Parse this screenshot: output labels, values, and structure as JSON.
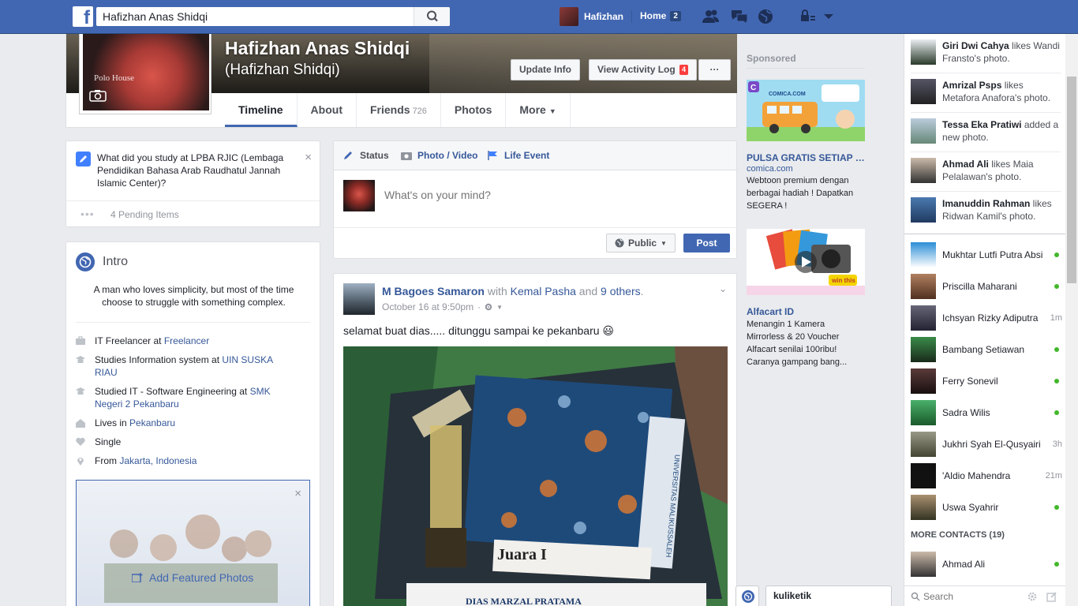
{
  "topbar": {
    "search_value": "Hafizhan Anas Shidqi",
    "user_name": "Hafizhan",
    "home_label": "Home",
    "home_count": "2"
  },
  "profile": {
    "name": "Hafizhan Anas Shidqi",
    "alt_name": "(Hafizhan Shidqi)",
    "picture_text": "Polo House",
    "update_info": "Update Info",
    "view_activity_log": "View Activity Log",
    "activity_count": "4",
    "more_button": "···",
    "tabs": [
      {
        "label": "Timeline",
        "count": ""
      },
      {
        "label": "About",
        "count": ""
      },
      {
        "label": "Friends",
        "count": "726"
      },
      {
        "label": "Photos",
        "count": ""
      },
      {
        "label": "More",
        "count": ""
      }
    ]
  },
  "study_card": {
    "question": "What did you study at LPBA RJIC (Lembaga Pendidikan Bahasa Arab Raudhatul Jannah Islamic Center)?",
    "close": "×",
    "pending_dots": "•••",
    "pending_label": "4 Pending Items"
  },
  "intro": {
    "title": "Intro",
    "bio": "A man who loves simplicity, but most of the time choose to struggle with something complex.",
    "rows": [
      {
        "prefix": "IT Freelancer at ",
        "link": "Freelancer",
        "suffix": ""
      },
      {
        "prefix": "Studies Information system at ",
        "link": "UIN SUSKA RIAU",
        "suffix": ""
      },
      {
        "prefix": "Studied IT - Software Engineering at ",
        "link": "SMK Negeri 2 Pekanbaru",
        "suffix": ""
      },
      {
        "prefix": "Lives in ",
        "link": "Pekanbaru",
        "suffix": ""
      },
      {
        "prefix": "Single",
        "link": "",
        "suffix": ""
      },
      {
        "prefix": "From ",
        "link": "Jakarta",
        "suffix": ", Indonesia"
      }
    ],
    "featured_close": "×",
    "featured_label": "Add Featured Photos"
  },
  "composer": {
    "tab_status": "Status",
    "tab_photo": "Photo / Video",
    "tab_life": "Life Event",
    "placeholder": "What's on your mind?",
    "privacy": "Public",
    "post_label": "Post"
  },
  "post": {
    "author": "M Bagoes Samaron",
    "with_text": " with ",
    "tagged": "Kemal Pasha",
    "and_text": " and ",
    "others": "9 others",
    "period": ".",
    "timestamp": "October 16 at 9:50pm",
    "meta_separator": "·",
    "text": "selamat buat dias..... ditunggu sampai ke pekanbaru 😃",
    "photo_caption": "Juara I",
    "photo_bottom": "DIAS MARZAL PRATAMA",
    "photo_side": "UNIVERSITAS MALIKUSSALEH"
  },
  "sponsored": {
    "title": "Sponsored",
    "ads": [
      {
        "title": "PULSA GRATIS SETIAP H...",
        "domain": "comica.com",
        "body": "Webtoon premium dengan berbagai hadiah ! Dapatkan SEGERA !",
        "img_text": "COMICA.COM"
      },
      {
        "title": "Alfacart ID",
        "domain": "",
        "body": "Menangin 1 Kamera Mirrorless & 20 Voucher Alfacart senilai 100ribu! Caranya gampang bang...",
        "img_text": "win this"
      }
    ]
  },
  "ticker": [
    {
      "name": "Giri Dwi Cahya",
      "action": " likes Wandi Fransto's photo."
    },
    {
      "name": "Amrizal Psps",
      "action": " likes Metafora Anafora's photo."
    },
    {
      "name": "Tessa Eka Pratiwi",
      "action": " added a new photo."
    },
    {
      "name": "Ahmad Ali",
      "action": " likes Maia Pelalawan's photo."
    },
    {
      "name": "Imanuddin Rahman",
      "action": " likes Ridwan Kamil's photo."
    }
  ],
  "contacts": [
    {
      "name": "Mukhtar Lutfi Putra Absi",
      "status": "online",
      "time": ""
    },
    {
      "name": "Priscilla Maharani",
      "status": "online",
      "time": ""
    },
    {
      "name": "Ichsyan Rizky Adiputra",
      "status": "idle",
      "time": "1m"
    },
    {
      "name": "Bambang Setiawan",
      "status": "online",
      "time": ""
    },
    {
      "name": "Ferry Sonevil",
      "status": "online",
      "time": ""
    },
    {
      "name": "Sadra Wilis",
      "status": "online",
      "time": ""
    },
    {
      "name": "Jukhri Syah El-Qusyairi",
      "status": "idle",
      "time": "3h"
    },
    {
      "name": "'Aldio Mahendra",
      "status": "idle",
      "time": "21m"
    },
    {
      "name": "Uswa Syahrir",
      "status": "online",
      "time": ""
    }
  ],
  "more_contacts": {
    "label": "MORE CONTACTS (19)",
    "items": [
      {
        "name": "Ahmad Ali",
        "status": "online",
        "time": ""
      }
    ]
  },
  "chat": {
    "search_placeholder": "Search",
    "dock_chat_name": "kuliketik"
  },
  "colors": {
    "brand": "#4267b2",
    "link": "#365899",
    "online": "#42b72a",
    "notification": "#fa3e3e"
  }
}
